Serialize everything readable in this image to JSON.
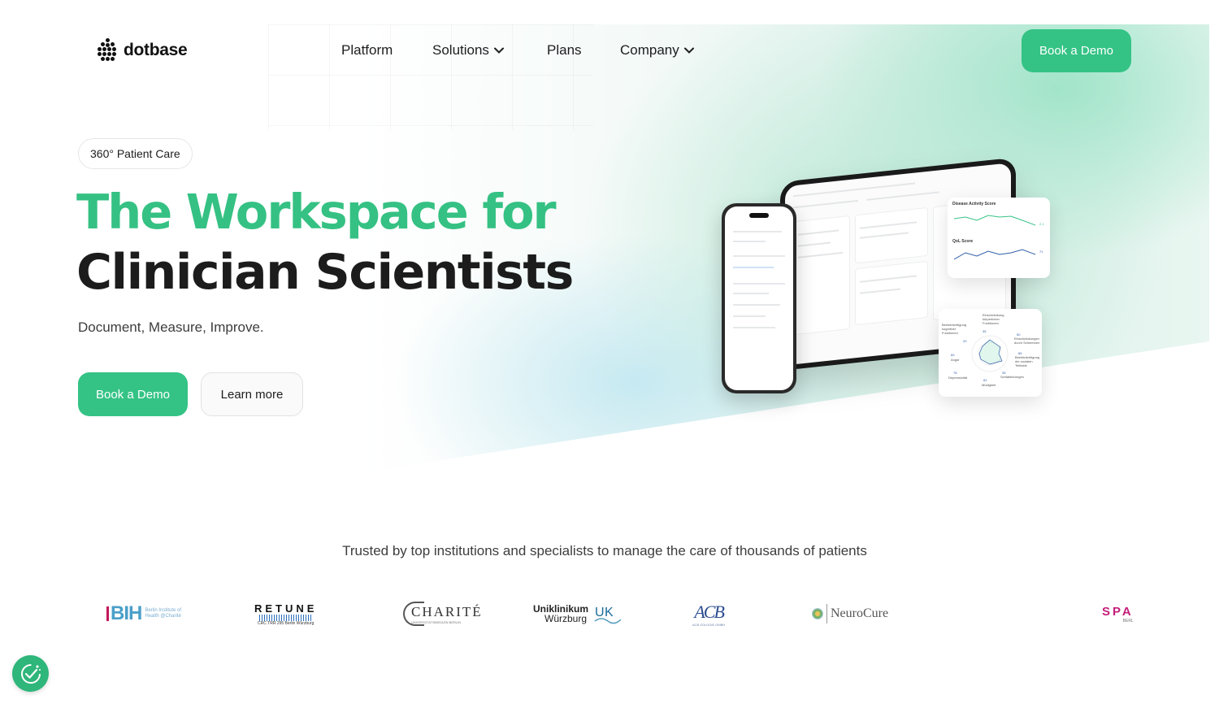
{
  "brand": {
    "name": "dotbase",
    "accent": "#34c385",
    "heading_green": "#35c183"
  },
  "nav": {
    "items": [
      {
        "label": "Platform",
        "has_dropdown": false
      },
      {
        "label": "Solutions",
        "has_dropdown": true
      },
      {
        "label": "Plans",
        "has_dropdown": false
      },
      {
        "label": "Company",
        "has_dropdown": true
      }
    ],
    "cta": "Book a Demo"
  },
  "hero": {
    "badge": "360° Patient Care",
    "headline_line1": "The Workspace for",
    "headline_line2": "Clinician Scientists",
    "subline": "Document, Measure, Improve.",
    "primary_cta": "Book a Demo",
    "secondary_cta": "Learn more"
  },
  "mockup": {
    "chart_widget": {
      "title1": "Disease Activity Score",
      "value1": "2.1",
      "title2": "QoL Score",
      "value2": "71"
    },
    "radar_widget": {
      "labels": [
        {
          "text": "Einschränkung körperlicher Funktionen",
          "value": "35"
        },
        {
          "text": "Beeinträchtigung kognitiver Funktionen",
          "value": "20"
        },
        {
          "text": "Einschränkungen durch Schmerzen",
          "value": "50"
        },
        {
          "text": "Angst",
          "value": "60"
        },
        {
          "text": "Beeinträchtigung der sozialen Teilhabe",
          "value": "65"
        },
        {
          "text": "Depressivität",
          "value": "78"
        },
        {
          "text": "Schlafstörungen",
          "value": "35"
        },
        {
          "text": "Müdigkeit",
          "value": "62"
        }
      ]
    }
  },
  "trusted": {
    "text": "Trusted by top institutions and specialists to manage the care of thousands of patients",
    "logos": [
      {
        "name": "BIH",
        "text": "BIH",
        "sub": "Berlin Institute of Health @Charité"
      },
      {
        "name": "RETUNE",
        "text": "RETUNE",
        "sub": "CRC TRR 295 Berlin Würzburg"
      },
      {
        "name": "CHARITÉ",
        "text": "CHARITÉ",
        "sub": "UNIVERSITÄTSMEDIZIN BERLIN"
      },
      {
        "name": "Uniklinikum Würzburg",
        "text": "Uniklinikum",
        "text2": "Würzburg"
      },
      {
        "name": "ACB",
        "text": "ACB",
        "sub": "ACB ZOLOGIE GMBH"
      },
      {
        "name": "NeuroCure",
        "text": "NeuroCure"
      },
      {
        "name": "SPA",
        "text": "SPA",
        "sub": "BERL"
      }
    ]
  }
}
